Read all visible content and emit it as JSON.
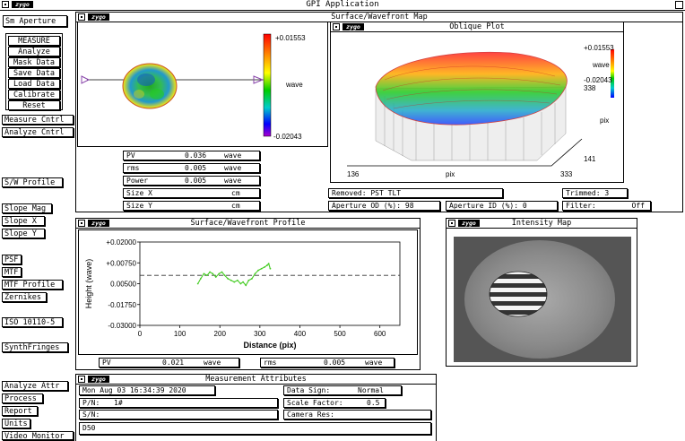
{
  "app": {
    "title": "GPI Application",
    "logo": "zygo"
  },
  "left_panel": {
    "aperture_button": "Sm Aperture",
    "measure_group": [
      "MEASURE",
      "Analyze",
      "Mask Data",
      "Save Data",
      "Load Data",
      "Calibrate",
      "Reset"
    ],
    "controls": {
      "measure_cntrl": "Measure Cntrl",
      "analyze_cntrl": "Analyze Cntrl",
      "sw_profile": "S/W Profile",
      "slope_mag": "Slope Mag",
      "slope_x": "Slope X",
      "slope_y": "Slope Y",
      "psf": "PSF",
      "mtf": "MTF",
      "mtf_profile": "MTF Profile",
      "zernikes": "Zernikes",
      "iso": "ISO 10110-5",
      "synth_fringes": "SynthFringes",
      "analyze_attr": "Analyze Attr",
      "process": "Process",
      "report": "Report",
      "units": "Units",
      "video_monitor": "Video Monitor"
    }
  },
  "surface_map": {
    "title": "Surface/Wavefront Map",
    "colorbar_max": "+0.01553",
    "colorbar_min": "-0.02043",
    "colorbar_unit": "wave",
    "stats": [
      {
        "label": "PV",
        "value": "0.036",
        "unit": "wave"
      },
      {
        "label": "rms",
        "value": "0.005",
        "unit": "wave"
      },
      {
        "label": "Power",
        "value": "0.005",
        "unit": "wave"
      },
      {
        "label": "Size X",
        "value": "",
        "unit": "cm"
      },
      {
        "label": "Size Y",
        "value": "",
        "unit": "cm"
      }
    ]
  },
  "oblique_plot": {
    "title": "Oblique Plot",
    "legend_max": "+0.01553",
    "legend_unit": "wave",
    "legend_min": "-0.02043",
    "axis_x_start": "136",
    "axis_x_label": "pix",
    "axis_x_end": "333",
    "axis_y_top": "338",
    "axis_y_label": "pix",
    "axis_y_bottom": "141"
  },
  "map_info": {
    "removed_label": "Removed:",
    "removed_value": "PST TLT",
    "trimmed_label": "Trimmed:",
    "trimmed_value": "3",
    "aperture_od_label": "Aperture OD (%):",
    "aperture_od_value": "98",
    "aperture_id_label": "Aperture ID (%):",
    "aperture_id_value": "0",
    "filter_label": "Filter:",
    "filter_value": "Off"
  },
  "profile": {
    "title": "Surface/Wavefront Profile",
    "pv_label": "PV",
    "pv_value": "0.021",
    "pv_unit": "wave",
    "rms_label": "rms",
    "rms_value": "0.005",
    "rms_unit": "wave"
  },
  "chart_data": {
    "type": "line",
    "title": "",
    "xlabel": "Distance (pix)",
    "ylabel": "Height (wave)",
    "xlim": [
      0,
      650
    ],
    "ylim": [
      -0.03,
      0.02
    ],
    "x_ticks": [
      "0",
      "100",
      "200",
      "300",
      "400",
      "500",
      "600"
    ],
    "y_ticks": [
      "+0.02000",
      "+0.00750",
      "0.00500",
      "-0.01750",
      "-0.03000"
    ],
    "reference_line_y": 0.0,
    "series": [
      {
        "color": "#44cc22",
        "x": [
          145,
          152,
          160,
          168,
          175,
          182,
          190,
          198,
          205,
          212,
          220,
          228,
          236,
          244,
          252,
          258,
          265,
          272,
          280,
          288,
          296,
          304,
          312,
          318,
          322,
          326
        ],
        "y": [
          -0.005,
          -0.002,
          0.001,
          0.0,
          0.002,
          0.001,
          -0.001,
          0.001,
          0.002,
          0.0,
          -0.002,
          -0.003,
          -0.004,
          -0.003,
          -0.005,
          -0.004,
          -0.006,
          -0.003,
          -0.002,
          0.001,
          0.003,
          0.004,
          0.005,
          0.006,
          0.007,
          0.004
        ]
      }
    ]
  },
  "intensity_map": {
    "title": "Intensity Map"
  },
  "attributes": {
    "title": "Measurement Attributes",
    "date": "Mon Aug 03 16:34:39 2020",
    "data_sign_label": "Data Sign:",
    "data_sign_value": "Normal",
    "pn_label": "P/N:",
    "pn_value": "1#",
    "scale_factor_label": "Scale Factor:",
    "scale_factor_value": "0.5",
    "sn_label": "S/N:",
    "sn_value": "",
    "camera_res_label": "Camera Res:",
    "camera_res_value": "",
    "note": "D50"
  }
}
